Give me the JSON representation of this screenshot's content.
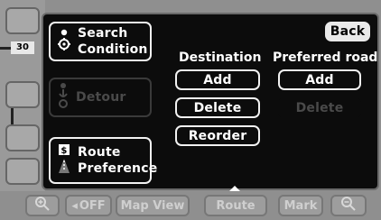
{
  "panel": {
    "back_label": "Back",
    "search_condition": {
      "line1": "Search",
      "line2": "Condition",
      "icon": "gear-icon"
    },
    "detour": {
      "label": "Detour",
      "icon": "detour-route-icon"
    },
    "route_preference": {
      "line1": "Route",
      "line2": "Preference",
      "icon": "route-preference-icon"
    },
    "destination": {
      "heading": "Destination",
      "add_label": "Add",
      "delete_label": "Delete",
      "reorder_label": "Reorder"
    },
    "preferred_road": {
      "heading": "Preferred road",
      "add_label": "Add",
      "delete_label": "Delete"
    }
  },
  "map_side": {
    "speed_badge": "30"
  },
  "bottom_bar": {
    "items": [
      {
        "label": "",
        "icon": "zoom-in-icon"
      },
      {
        "label": "OFF"
      },
      {
        "label": "Map View"
      },
      {
        "label": "Route"
      },
      {
        "label": "Mark"
      },
      {
        "label": "",
        "icon": "zoom-out-icon"
      }
    ]
  }
}
